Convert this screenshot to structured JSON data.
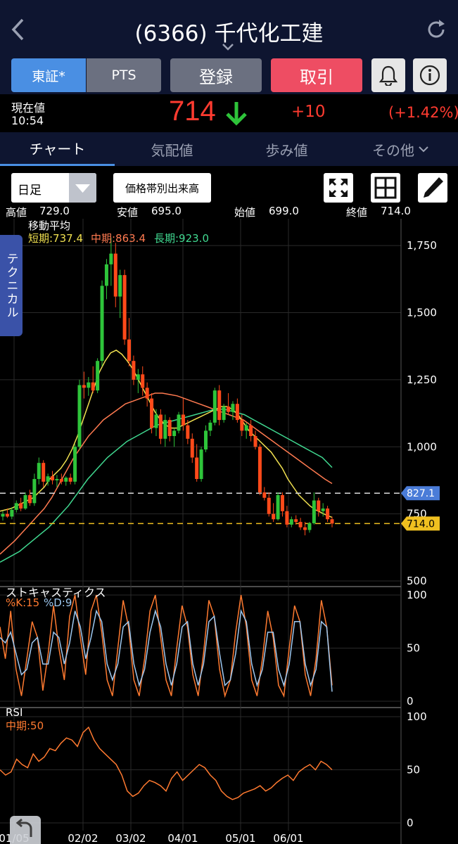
{
  "header": {
    "title": "(6366) 千代化工建"
  },
  "buttons": {
    "tse": "東証*",
    "pts": "PTS",
    "register": "登録",
    "trade": "取引"
  },
  "quote": {
    "label": "現在値",
    "time": "10:54",
    "price": "714",
    "change": "+10",
    "change_pct": "(+1.42%)"
  },
  "tabs": [
    "チャート",
    "気配値",
    "歩み値",
    "その他"
  ],
  "toolbar": {
    "period": "日足",
    "volume_button": "価格帯別出来高"
  },
  "ohlc": {
    "high_label": "高値",
    "high": "729.0",
    "low_label": "安値",
    "low": "695.0",
    "open_label": "始値",
    "open": "699.0",
    "close_label": "終値",
    "close": "714.0"
  },
  "side_tab": "テクニカル",
  "indicators": {
    "ma": {
      "title": "移動平均",
      "short": "短期:737.4",
      "mid": "中期:863.4",
      "long": "長期:923.0"
    },
    "stoch": {
      "title": "ストキャスティクス",
      "k": "%K:15",
      "d": "%D:9"
    },
    "rsi": {
      "title": "RSI",
      "mid": "中期:50"
    }
  },
  "colors": {
    "up": "#2ec43a",
    "down": "#ff4a1a",
    "ma_short": "#f0e050",
    "ma_mid": "#ff7a50",
    "ma_long": "#40d890",
    "stoch_k": "#ff7a30",
    "stoch_d": "#9ec8f0",
    "rsi": "#ff7a30"
  },
  "chart_data": {
    "type": "candlestick",
    "ylim": [
      500,
      1850
    ],
    "y_ticks": [
      "1,750",
      "1,500",
      "1,250",
      "1,000",
      "750",
      "500"
    ],
    "x_ticks": [
      "01/05",
      "02/02",
      "03/02",
      "04/01",
      "05/01",
      "06/01"
    ],
    "price_marker": "827.1",
    "last_marker": "714.0",
    "candles": [
      [
        740,
        760,
        725,
        750
      ],
      [
        750,
        770,
        735,
        740
      ],
      [
        740,
        775,
        730,
        765
      ],
      [
        765,
        800,
        755,
        790
      ],
      [
        790,
        810,
        760,
        770
      ],
      [
        770,
        830,
        765,
        820
      ],
      [
        820,
        840,
        780,
        790
      ],
      [
        790,
        900,
        780,
        880
      ],
      [
        880,
        960,
        860,
        940
      ],
      [
        940,
        950,
        850,
        870
      ],
      [
        870,
        900,
        855,
        890
      ],
      [
        890,
        910,
        860,
        875
      ],
      [
        875,
        895,
        850,
        880
      ],
      [
        880,
        900,
        860,
        870
      ],
      [
        870,
        890,
        855,
        885
      ],
      [
        885,
        900,
        860,
        870
      ],
      [
        870,
        1010,
        860,
        1000
      ],
      [
        1000,
        1250,
        990,
        1230
      ],
      [
        1230,
        1280,
        1180,
        1220
      ],
      [
        1220,
        1260,
        1190,
        1240
      ],
      [
        1240,
        1300,
        1200,
        1210
      ],
      [
        1210,
        1330,
        1200,
        1320
      ],
      [
        1320,
        1620,
        1300,
        1600
      ],
      [
        1600,
        1700,
        1550,
        1680
      ],
      [
        1680,
        1780,
        1600,
        1720
      ],
      [
        1720,
        1760,
        1520,
        1560
      ],
      [
        1560,
        1660,
        1480,
        1640
      ],
      [
        1640,
        1660,
        1380,
        1400
      ],
      [
        1400,
        1480,
        1300,
        1320
      ],
      [
        1320,
        1340,
        1230,
        1250
      ],
      [
        1250,
        1290,
        1200,
        1270
      ],
      [
        1270,
        1300,
        1190,
        1220
      ],
      [
        1220,
        1240,
        1150,
        1180
      ],
      [
        1180,
        1200,
        1050,
        1070
      ],
      [
        1070,
        1140,
        1040,
        1120
      ],
      [
        1120,
        1140,
        1010,
        1030
      ],
      [
        1030,
        1120,
        1000,
        1100
      ],
      [
        1100,
        1110,
        1020,
        1040
      ],
      [
        1040,
        1070,
        1000,
        1060
      ],
      [
        1060,
        1130,
        1050,
        1120
      ],
      [
        1120,
        1180,
        1060,
        1080
      ],
      [
        1080,
        1100,
        1010,
        1030
      ],
      [
        1030,
        1050,
        940,
        960
      ],
      [
        960,
        1010,
        870,
        880
      ],
      [
        880,
        1000,
        870,
        990
      ],
      [
        990,
        1080,
        980,
        1060
      ],
      [
        1060,
        1100,
        1040,
        1090
      ],
      [
        1090,
        1220,
        1080,
        1210
      ],
      [
        1210,
        1230,
        1080,
        1100
      ],
      [
        1100,
        1160,
        1090,
        1150
      ],
      [
        1150,
        1200,
        1120,
        1130
      ],
      [
        1130,
        1170,
        1100,
        1160
      ],
      [
        1160,
        1180,
        1090,
        1100
      ],
      [
        1100,
        1120,
        1040,
        1060
      ],
      [
        1060,
        1090,
        1030,
        1080
      ],
      [
        1080,
        1100,
        1020,
        1040
      ],
      [
        1040,
        1060,
        990,
        1000
      ],
      [
        1000,
        1010,
        820,
        830
      ],
      [
        830,
        850,
        800,
        810
      ],
      [
        810,
        830,
        740,
        750
      ],
      [
        750,
        790,
        720,
        730
      ],
      [
        730,
        830,
        725,
        820
      ],
      [
        820,
        830,
        740,
        760
      ],
      [
        760,
        780,
        700,
        710
      ],
      [
        710,
        740,
        700,
        730
      ],
      [
        730,
        745,
        710,
        720
      ],
      [
        720,
        735,
        690,
        700
      ],
      [
        700,
        720,
        670,
        690
      ],
      [
        690,
        720,
        680,
        715
      ],
      [
        715,
        830,
        710,
        800
      ],
      [
        800,
        810,
        740,
        760
      ],
      [
        760,
        790,
        740,
        770
      ],
      [
        770,
        780,
        720,
        730
      ],
      [
        730,
        740,
        700,
        714
      ]
    ],
    "ma_short": [
      760,
      765,
      770,
      780,
      790,
      800,
      810,
      830,
      850,
      880,
      900,
      920,
      950,
      990,
      1040,
      1100,
      1160,
      1220,
      1280,
      1320,
      1350,
      1360,
      1345,
      1320,
      1290,
      1250,
      1210,
      1170,
      1130,
      1100,
      1080,
      1070,
      1070,
      1080,
      1090,
      1100,
      1110,
      1120,
      1130,
      1140,
      1150,
      1150,
      1140,
      1120,
      1090,
      1060,
      1040,
      1020,
      1000,
      980,
      950,
      920,
      880,
      850,
      820,
      800,
      780,
      765,
      755,
      745,
      737
    ],
    "ma_mid": [
      600,
      625,
      650,
      680,
      710,
      740,
      770,
      810,
      860,
      910,
      960,
      1000,
      1040,
      1070,
      1100,
      1120,
      1140,
      1160,
      1170,
      1180,
      1190,
      1200,
      1200,
      1195,
      1190,
      1180,
      1170,
      1160,
      1150,
      1140,
      1130,
      1120,
      1110,
      1100,
      1080,
      1060,
      1040,
      1020,
      1000,
      980,
      960,
      940,
      920,
      900,
      880,
      863
    ],
    "ma_long": [
      570,
      590,
      610,
      640,
      670,
      700,
      740,
      780,
      830,
      880,
      920,
      960,
      990,
      1020,
      1040,
      1060,
      1080,
      1090,
      1100,
      1110,
      1120,
      1130,
      1140,
      1140,
      1130,
      1120,
      1100,
      1080,
      1060,
      1040,
      1020,
      1000,
      980,
      960,
      923
    ],
    "stoch_k": [
      70,
      40,
      85,
      30,
      5,
      40,
      75,
      60,
      10,
      45,
      90,
      50,
      20,
      80,
      100,
      60,
      25,
      85,
      100,
      65,
      20,
      5,
      50,
      95,
      70,
      20,
      5,
      40,
      85,
      100,
      60,
      20,
      5,
      50,
      90,
      70,
      25,
      5,
      45,
      95,
      80,
      30,
      5,
      20,
      65,
      100,
      70,
      20,
      5,
      40,
      85,
      60,
      15,
      5,
      50,
      90,
      75,
      25,
      5,
      40,
      95,
      70,
      15
    ],
    "stoch_d": [
      60,
      55,
      65,
      45,
      25,
      30,
      55,
      60,
      35,
      35,
      65,
      60,
      35,
      55,
      85,
      70,
      40,
      60,
      85,
      75,
      35,
      20,
      35,
      70,
      75,
      35,
      15,
      30,
      65,
      85,
      70,
      35,
      15,
      35,
      70,
      75,
      35,
      15,
      35,
      75,
      80,
      45,
      15,
      20,
      45,
      85,
      75,
      35,
      15,
      30,
      65,
      65,
      30,
      15,
      35,
      75,
      75,
      35,
      15,
      30,
      75,
      70,
      9
    ],
    "rsi": [
      50,
      45,
      48,
      60,
      55,
      52,
      65,
      58,
      62,
      70,
      68,
      75,
      80,
      78,
      72,
      85,
      90,
      78,
      70,
      65,
      60,
      55,
      45,
      30,
      25,
      28,
      35,
      40,
      38,
      35,
      30,
      42,
      48,
      40,
      45,
      50,
      55,
      52,
      45,
      40,
      30,
      25,
      22,
      24,
      28,
      30,
      32,
      35,
      30,
      33,
      38,
      42,
      45,
      40,
      48,
      52,
      55,
      50,
      58,
      55,
      50
    ]
  }
}
